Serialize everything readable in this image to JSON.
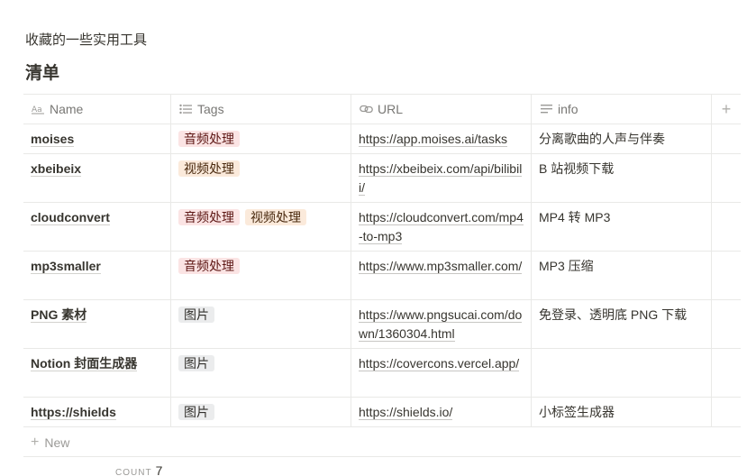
{
  "intro": "收藏的一些实用工具",
  "title": "清单",
  "columns": {
    "name": "Name",
    "tags": "Tags",
    "url": "URL",
    "info": "info",
    "add": "+"
  },
  "tag_colors": {
    "音频处理": "#fbe4e4",
    "视频处理": "#fbeadb",
    "图片": "#ebeced"
  },
  "rows": [
    {
      "name": "moises",
      "tags": [
        "音频处理"
      ],
      "url": "https://app.moises.ai/tasks",
      "info": "分离歌曲的人声与伴奏"
    },
    {
      "name": "xbeibeix",
      "tags": [
        "视频处理"
      ],
      "url": "https://xbeibeix.com/api/bilibili/",
      "info": "B 站视频下载"
    },
    {
      "name": "cloudconvert",
      "tags": [
        "音频处理",
        "视频处理"
      ],
      "url": "https://cloudconvert.com/mp4-to-mp3",
      "info": "MP4 转 MP3"
    },
    {
      "name": "mp3smaller",
      "tags": [
        "音频处理"
      ],
      "url": "https://www.mp3smaller.com/",
      "info": "MP3 压缩"
    },
    {
      "name": "PNG 素材",
      "tags": [
        "图片"
      ],
      "url": "https://www.pngsucai.com/down/1360304.html",
      "info": "免登录、透明底 PNG 下载"
    },
    {
      "name": "Notion 封面生成器",
      "tags": [
        "图片"
      ],
      "url": "https://covercons.vercel.app/",
      "info": ""
    },
    {
      "name": "https://shields",
      "tags": [
        "图片"
      ],
      "url": "https://shields.io/",
      "info": "小标签生成器"
    }
  ],
  "new_label": "New",
  "count_label": "COUNT",
  "count_value": "7"
}
